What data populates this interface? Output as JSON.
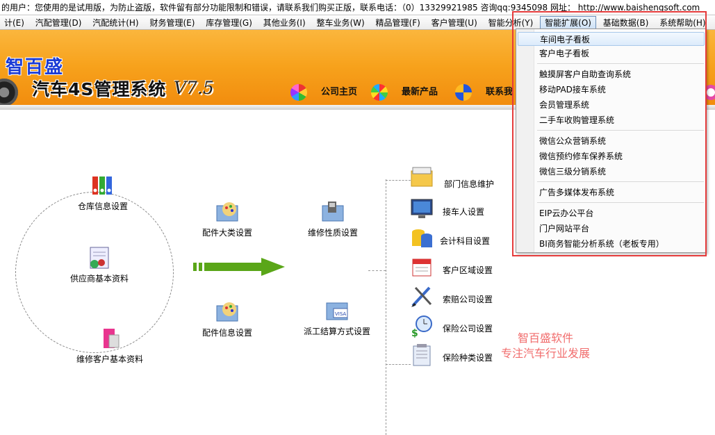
{
  "title_bar": {
    "text": "的用户：您使用的是试用版，为防止盗版，软件留有部分功能限制和错误，请联系我们购买正版，联系电话：（0）13329921985  咨询qq:9345098   网址：  http://www.baishengsoft.com"
  },
  "menubar": {
    "items": [
      {
        "label": "计(E)"
      },
      {
        "label": "汽配管理(D)"
      },
      {
        "label": "汽配统计(H)"
      },
      {
        "label": "财务管理(E)"
      },
      {
        "label": "库存管理(G)"
      },
      {
        "label": "其他业务(I)"
      },
      {
        "label": "整车业务(W)"
      },
      {
        "label": "精品管理(F)"
      },
      {
        "label": "客户管理(U)"
      },
      {
        "label": "智能分析(Y)"
      },
      {
        "label": "智能扩展(O)"
      },
      {
        "label": "基础数据(B)"
      },
      {
        "label": "系统帮助(H)"
      }
    ]
  },
  "banner": {
    "brand": "智百盛",
    "app_title": "汽车4S管理系统",
    "version": "V7.5",
    "nav": [
      {
        "label": "公司主页",
        "icon": "pinwheel-icon"
      },
      {
        "label": "最新产品",
        "icon": "flower-icon"
      },
      {
        "label": "联系我",
        "icon": "swirl-icon"
      }
    ]
  },
  "workflow": {
    "circle_nodes": [
      {
        "label": "仓库信息设置",
        "icon": "binders-icon"
      },
      {
        "label": "供应商基本资料",
        "icon": "supplier-icon"
      },
      {
        "label": "维修客户基本资料",
        "icon": "customer-folder-icon"
      }
    ],
    "middle_nodes": [
      {
        "label": "配件大类设置",
        "icon": "palette-folder-icon"
      },
      {
        "label": "配件信息设置",
        "icon": "palette-folder-icon"
      },
      {
        "label": "维修性质设置",
        "icon": "repair-folder-icon"
      },
      {
        "label": "派工结算方式设置",
        "icon": "card-folder-icon"
      }
    ],
    "right_items": [
      {
        "label": "部门信息维护",
        "icon": "folder-icon"
      },
      {
        "label": "接车人设置",
        "icon": "monitor-icon"
      },
      {
        "label": "会计科目设置",
        "icon": "database-icon"
      },
      {
        "label": "客户区域设置",
        "icon": "calendar-icon"
      },
      {
        "label": "索赔公司设置",
        "icon": "pen-tools-icon"
      },
      {
        "label": "保险公司设置",
        "icon": "money-clock-icon"
      },
      {
        "label": "保险种类设置",
        "icon": "notepad-icon"
      }
    ]
  },
  "promo": {
    "line1": "智百盛软件",
    "line2": "专注汽车行业发展"
  },
  "dropdown": {
    "items": [
      {
        "label": "车间电子看板",
        "highlight": true
      },
      {
        "label": "客户电子看板"
      },
      {
        "label": "触摸屏客户自助查询系统"
      },
      {
        "label": "移动PAD接车系统"
      },
      {
        "label": "会员管理系统"
      },
      {
        "label": "二手车收购管理系统"
      },
      {
        "label": "微信公众营销系统"
      },
      {
        "label": "微信预约修车保养系统"
      },
      {
        "label": "微信三级分销系统"
      },
      {
        "label": "广告多媒体发布系统"
      },
      {
        "label": "EIP云办公平台"
      },
      {
        "label": "门户网站平台"
      },
      {
        "label": "BI商务智能分析系统（老板专用）"
      }
    ]
  },
  "colors": {
    "banner_orange": "#f7a21c",
    "highlight_red": "#e53b3b",
    "promo_pink": "#f16d6d",
    "arrow_green": "#5aa618",
    "brand_blue": "#1a3bd6"
  }
}
